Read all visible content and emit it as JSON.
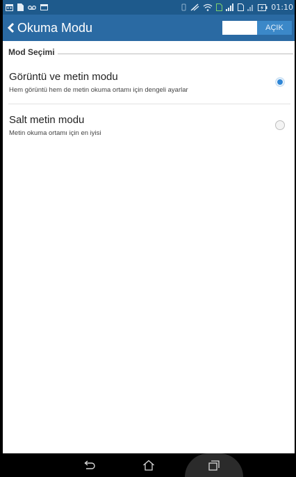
{
  "status_bar": {
    "left_icons": [
      "calendar-icon",
      "document-icon",
      "voicemail-icon",
      "image-icon"
    ],
    "right_icons": [
      "vibrate-icon",
      "no-data-icon",
      "wifi-icon",
      "sim-icon",
      "signal-icon",
      "sim2-icon",
      "signal2-icon",
      "battery-charging-icon"
    ],
    "time": "01:10"
  },
  "action_bar": {
    "title": "Okuma Modu",
    "toggle_label": "AÇIK",
    "toggle_state": "on"
  },
  "section": {
    "title": "Mod Seçimi"
  },
  "options": [
    {
      "title": "Görüntü ve metin modu",
      "subtitle": "Hem görüntü hem de metin okuma ortamı için dengeli ayarlar",
      "selected": true
    },
    {
      "title": "Salt metin modu",
      "subtitle": "Metin okuma ortamı için en iyisi",
      "selected": false
    }
  ],
  "nav_bar": {
    "buttons": [
      "back-icon",
      "home-icon",
      "recents-icon"
    ]
  },
  "colors": {
    "status_bar": "#1e5a8c",
    "action_bar": "#2a6aa3",
    "toggle_on": "#3b88c8",
    "radio_selected": "#2f86d6"
  }
}
